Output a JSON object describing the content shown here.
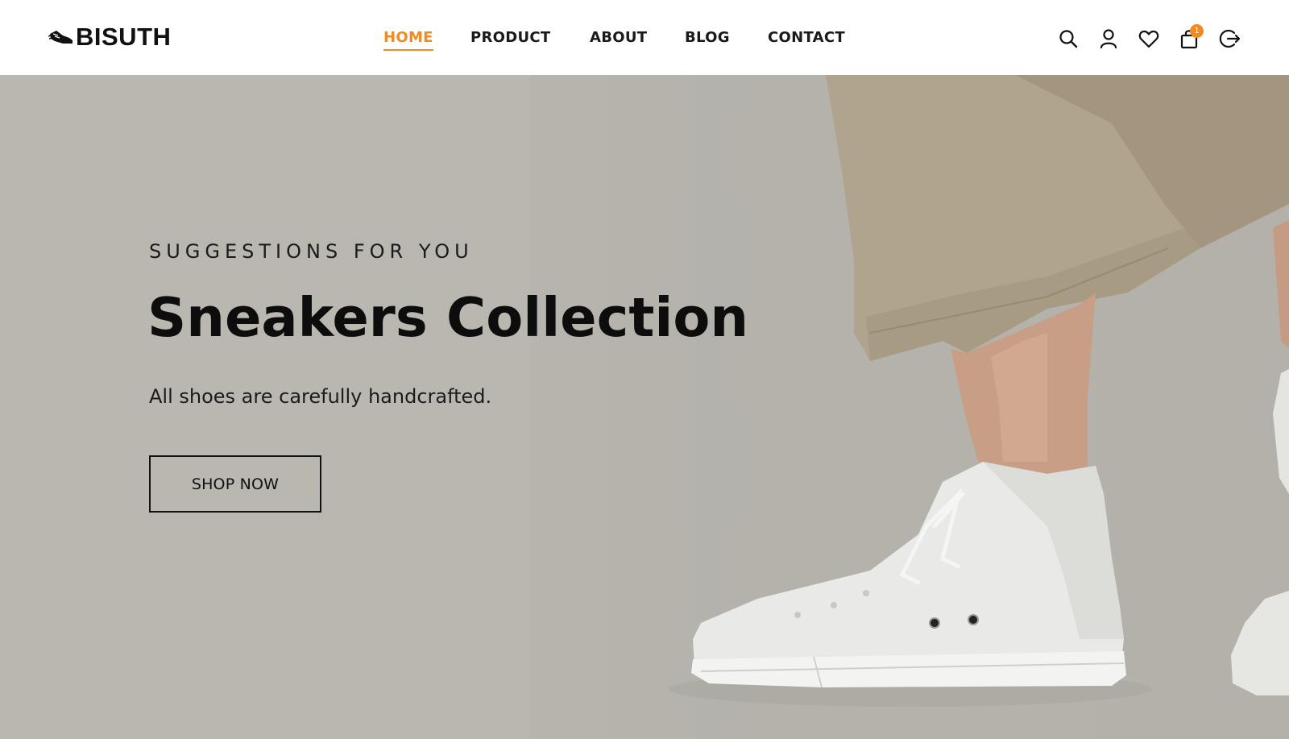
{
  "brand": {
    "name": "BISUTH",
    "logo_icon": "sneaker-icon"
  },
  "nav": {
    "items": [
      {
        "label": "HOME",
        "active": true
      },
      {
        "label": "PRODUCT",
        "active": false
      },
      {
        "label": "ABOUT",
        "active": false
      },
      {
        "label": "BLOG",
        "active": false
      },
      {
        "label": "CONTACT",
        "active": false
      }
    ]
  },
  "header_icons": {
    "search": "search-icon",
    "account": "user-icon",
    "wishlist": "heart-icon",
    "cart": "shopping-bag-icon",
    "cart_count": "1",
    "logout": "logout-icon"
  },
  "hero": {
    "eyebrow": "SUGGESTIONS FOR YOU",
    "title": "Sneakers Collection",
    "subtitle": "All shoes are carefully handcrafted.",
    "cta_label": "SHOP NOW"
  },
  "colors": {
    "accent": "#f28a22",
    "hero_bg": "#bab7b0",
    "text": "#111111",
    "header_bg": "#ffffff"
  }
}
